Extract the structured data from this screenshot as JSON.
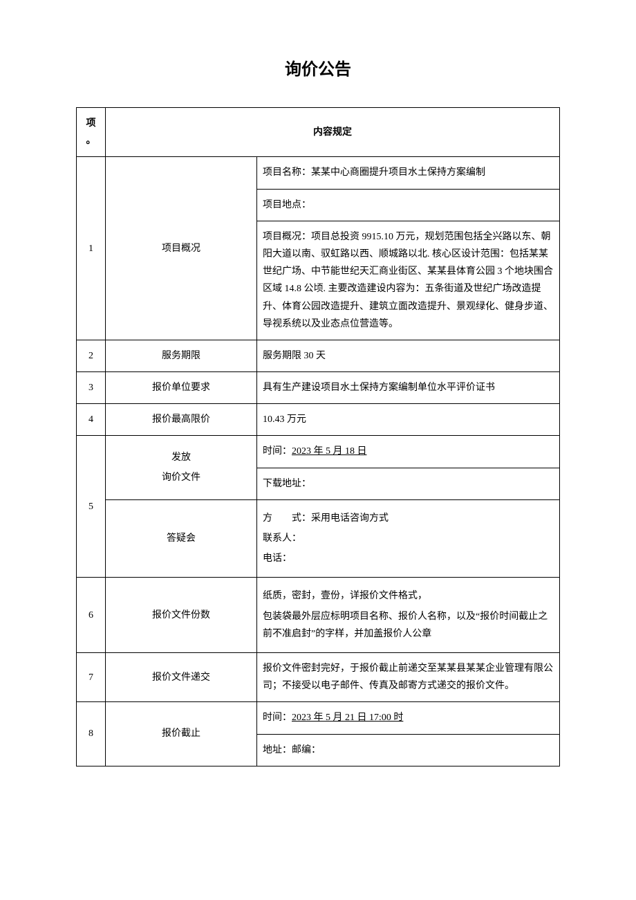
{
  "title": "询价公告",
  "header": {
    "col1": "项。",
    "col2": "内容规定"
  },
  "rows": {
    "r1": {
      "idx": "1",
      "label": "项目概况",
      "name": "项目名称：某某中心商圈提升项目水土保持方案编制",
      "loc": "项目地点：",
      "overview": "项目概况：项目总投资 9915.10 万元，规划范围包括全兴路以东、朝阳大道以南、驭虹路以西、顺城路以北. 核心区设计范围：包括某某世纪广场、中节能世纪天汇商业街区、某某县体育公园 3 个地块围合区域 14.8 公顷. 主要改造建设内容为：五条街道及世纪广场改造提升、体育公园改造提升、建筑立面改造提升、景观绿化、健身步道、导视系统以及业态点位营造等。"
    },
    "r2": {
      "idx": "2",
      "label": "服务期限",
      "content": "服务期限 30 天"
    },
    "r3": {
      "idx": "3",
      "label": "报价单位要求",
      "content": "具有生产建设项目水土保持方案编制单位水平评价证书"
    },
    "r4": {
      "idx": "4",
      "label": "报价最高限价",
      "content": "10.43 万元"
    },
    "r5": {
      "idx": "5",
      "sub1": "发放",
      "sub1b": "询价文件",
      "time_prefix": "时间：",
      "time_val": "2023 年 5 月 18 日",
      "download": "下载地址：",
      "sub2": "答疑会",
      "method": "方　　式：采用电话咨询方式",
      "contact": "联系人：",
      "phone": "电话："
    },
    "r6": {
      "idx": "6",
      "label": "报价文件份数",
      "line1": "纸质，密封，壹份，详报价文件格式，",
      "line2": "包装袋最外层应标明项目名称、报价人名称，以及“报价时间截止之前不准启封”的字样，并加盖报价人公章"
    },
    "r7": {
      "idx": "7",
      "label": "报价文件递交",
      "content": "报价文件密封完好，于报价截止前递交至某某县某某企业管理有限公司；不接受以电子邮件、传真及邮寄方式递交的报价文件。"
    },
    "r8": {
      "idx": "8",
      "label": "报价截止",
      "time_prefix": "时间：",
      "time_val": "2023 年 5 月 21 日 17:00 时",
      "addr": "地址：邮编："
    }
  }
}
